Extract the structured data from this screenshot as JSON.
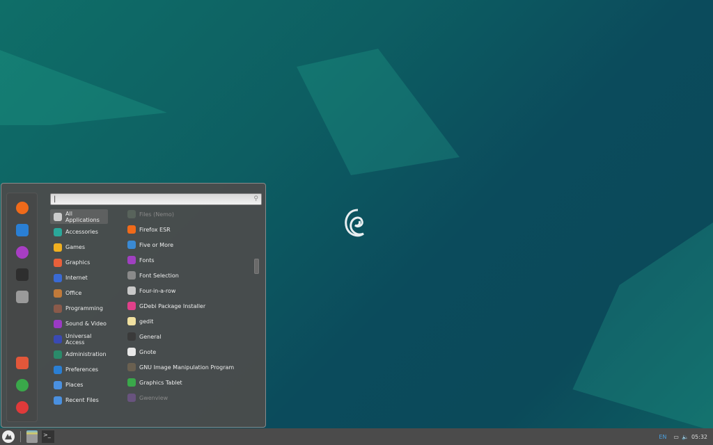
{
  "desktop": {
    "accent": "#0e6a68"
  },
  "favorites": [
    {
      "name": "firefox",
      "color": "#f06a1a"
    },
    {
      "name": "settings",
      "color": "#2a7fd4"
    },
    {
      "name": "gnome-tweaks",
      "color": "#a83ec4"
    },
    {
      "name": "terminal",
      "color": "#2e2e2e"
    },
    {
      "name": "files",
      "color": "#9a9a9a"
    }
  ],
  "session": [
    {
      "name": "lock-screen",
      "color": "#e2573a"
    },
    {
      "name": "logout",
      "color": "#3aa84a"
    },
    {
      "name": "power",
      "color": "#e03a3a"
    }
  ],
  "search": {
    "value": "",
    "placeholder": ""
  },
  "categories": [
    {
      "label": "All Applications",
      "color": "#cccccc"
    },
    {
      "label": "Accessories",
      "color": "#2aa89a"
    },
    {
      "label": "Games",
      "color": "#f0b020"
    },
    {
      "label": "Graphics",
      "color": "#e8603a"
    },
    {
      "label": "Internet",
      "color": "#3a6ad4"
    },
    {
      "label": "Office",
      "color": "#c07a3a"
    },
    {
      "label": "Programming",
      "color": "#8a5a4a"
    },
    {
      "label": "Sound & Video",
      "color": "#9a3ac4"
    },
    {
      "label": "Universal Access",
      "color": "#3a4ab4"
    },
    {
      "label": "Administration",
      "color": "#2a8a6a"
    },
    {
      "label": "Preferences",
      "color": "#2a7fd4"
    },
    {
      "label": "Places",
      "color": "#4a90e0"
    },
    {
      "label": "Recent Files",
      "color": "#4a90e0"
    }
  ],
  "apps": [
    {
      "label": "Files (Nemo)",
      "color": "#6a7a6a",
      "dim": true
    },
    {
      "label": "Firefox ESR",
      "color": "#f06a1a"
    },
    {
      "label": "Five or More",
      "color": "#3a8ad4"
    },
    {
      "label": "Fonts",
      "color": "#a040c0"
    },
    {
      "label": "Font Selection",
      "color": "#8a8a8a"
    },
    {
      "label": "Four-in-a-row",
      "color": "#c8c8c8"
    },
    {
      "label": "GDebi Package Installer",
      "color": "#e0408a"
    },
    {
      "label": "gedit",
      "color": "#f0e0a0"
    },
    {
      "label": "General",
      "color": "#3a3a3a"
    },
    {
      "label": "Gnote",
      "color": "#e8e8e8"
    },
    {
      "label": "GNU Image Manipulation Program",
      "color": "#6a6050"
    },
    {
      "label": "Graphics Tablet",
      "color": "#3aa84a"
    },
    {
      "label": "Gwenview",
      "color": "#8a5ab0",
      "dim": true
    }
  ],
  "taskbar": {
    "language": "EN",
    "clock": "05:32"
  }
}
